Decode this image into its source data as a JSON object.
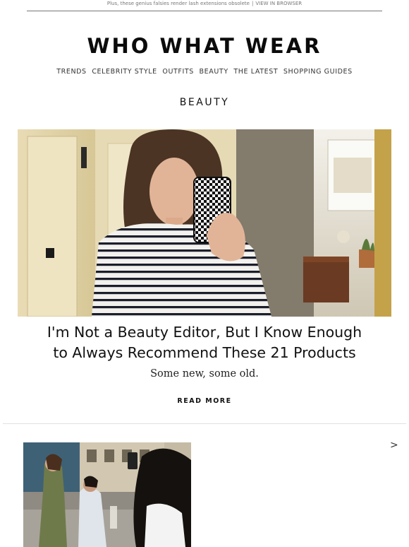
{
  "preheader": {
    "text": "Plus, these genius falsies render lash extensions obsolete",
    "separator": "|",
    "link": "VIEW IN BROWSER"
  },
  "brand": {
    "logo": "WHO WHAT WEAR"
  },
  "nav": {
    "items": [
      "TRENDS",
      "CELEBRITY STYLE",
      "OUTFITS",
      "BEAUTY",
      "THE LATEST",
      "SHOPPING GUIDES"
    ]
  },
  "section": {
    "title": "BEAUTY"
  },
  "article": {
    "headline_line1": "I'm Not a Beauty Editor, But I Know Enough",
    "headline_line2": "to Always Recommend These 21 Products",
    "dek": "Some new, some old.",
    "cta": "READ MORE"
  },
  "carousel": {
    "next_icon_glyph": ">"
  },
  "colors": {
    "text": "#111111",
    "rule": "#777777",
    "divider": "#e1e1e1"
  }
}
